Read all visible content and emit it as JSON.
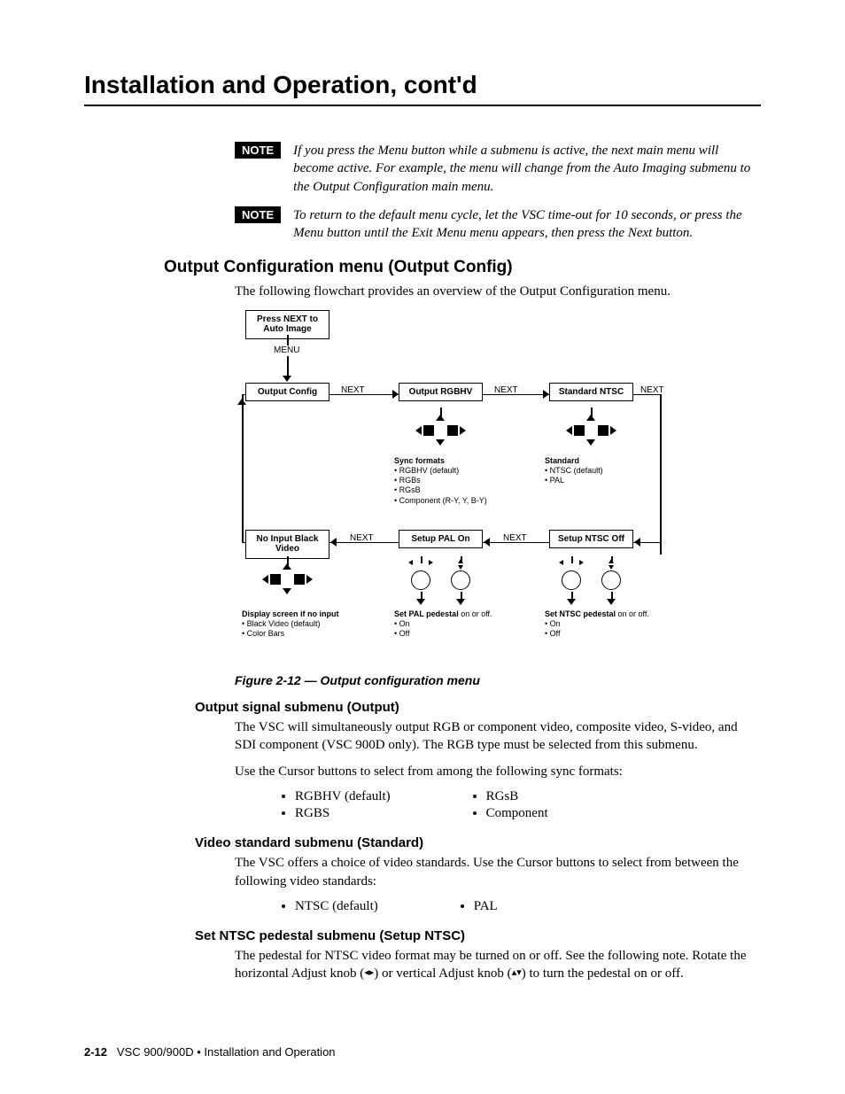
{
  "pageTitle": "Installation and Operation, cont'd",
  "notes": [
    {
      "label": "NOTE",
      "text": "If you press the Menu button while a submenu is active, the next main menu will become active.  For example, the menu will change from the Auto Imaging submenu to the Output Configuration main menu."
    },
    {
      "label": "NOTE",
      "text": "To return to the default menu cycle, let the VSC time-out for 10 seconds, or press the Menu button until the Exit Menu menu appears, then press the Next button."
    }
  ],
  "section": {
    "title": "Output Configuration menu (Output Config)",
    "intro": "The following flowchart provides an overview of the Output Configuration menu."
  },
  "figureCaption": "Figure 2-12 — Output configuration menu",
  "flow": {
    "topBox": "Press NEXT to Auto Image",
    "menuLabel": "MENU",
    "nextLabel": "NEXT",
    "boxes": {
      "outConfig": "Output Config",
      "outRGBHV": "Output RGBHV",
      "stdNTSC": "Standard NTSC",
      "noInput": "No Input Black Video",
      "setupPAL": "Setup PAL On",
      "setupNTSC": "Setup NTSC Off"
    },
    "details": {
      "sync": {
        "title": "Sync formats",
        "items": [
          "RGBHV (default)",
          "RGBs",
          "RGsB",
          "Component (R-Y, Y, B-Y)"
        ]
      },
      "standard": {
        "title": "Standard",
        "items": [
          "NTSC (default)",
          "PAL"
        ]
      },
      "display": {
        "title": "Display screen if no input",
        "items": [
          "Black Video (default)",
          "Color Bars"
        ]
      },
      "setPal": {
        "title": "Set PAL pedestal",
        "suffix": " on or off.",
        "items": [
          "On",
          "Off"
        ]
      },
      "setNtsc": {
        "title": "Set NTSC pedestal",
        "suffix": " on or off.",
        "items": [
          "On",
          "Off"
        ]
      }
    }
  },
  "sub1": {
    "title": "Output signal submenu (Output)",
    "p1": "The VSC will simultaneously output RGB or component video, composite video, S-video, and SDI component (VSC 900D only).  The RGB type must be selected from this submenu.",
    "p2": "Use the Cursor buttons to select from among the following sync formats:",
    "col1": [
      "RGBHV (default)",
      "RGBS"
    ],
    "col2": [
      "RGsB",
      "Component"
    ]
  },
  "sub2": {
    "title": "Video standard submenu (Standard)",
    "p1": "The VSC offers a choice of video standards.  Use the Cursor buttons to select from between the following video standards:",
    "col1": [
      "NTSC (default)"
    ],
    "col2": [
      "PAL"
    ]
  },
  "sub3": {
    "title": "Set NTSC pedestal submenu (Setup NTSC)",
    "p1a": "The pedestal for NTSC video format may be turned on or off.  See the following note.  Rotate the horizontal Adjust knob (",
    "p1b": ") or vertical Adjust knob (",
    "p1c": ") to turn the pedestal on or off."
  },
  "footer": {
    "page": "2-12",
    "product": "VSC 900/900D • Installation and Operation"
  }
}
